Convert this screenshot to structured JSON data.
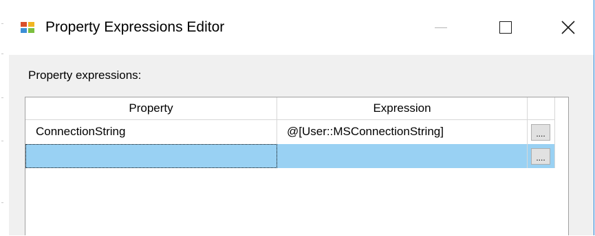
{
  "window": {
    "title": "Property Expressions Editor",
    "icon": "ssis-app-icon",
    "controls": [
      "minimize-icon",
      "maximize-icon",
      "close-icon"
    ],
    "accent_color": "#1e7fd6"
  },
  "content": {
    "section_label": "Property expressions:"
  },
  "grid": {
    "columns": [
      "Property",
      "Expression",
      ""
    ],
    "rows": [
      {
        "property": "ConnectionString",
        "expression": "@[User::MSConnectionString]",
        "button": "...."
      },
      {
        "property": "",
        "expression": "",
        "button": "....",
        "selected": true
      }
    ],
    "selection_color": "#99d1f3"
  }
}
